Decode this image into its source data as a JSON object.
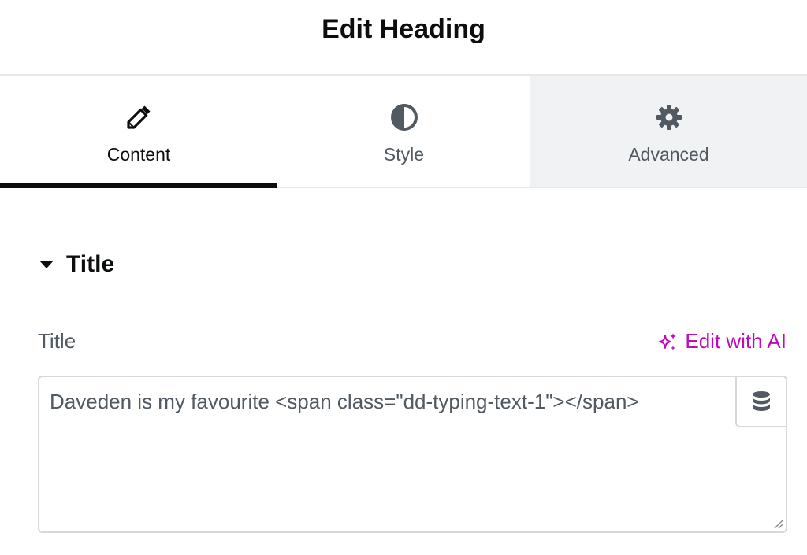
{
  "header": {
    "title": "Edit Heading"
  },
  "tabs": [
    {
      "label": "Content",
      "icon": "pencil-icon",
      "active": true
    },
    {
      "label": "Style",
      "icon": "half-circle-icon",
      "active": false
    },
    {
      "label": "Advanced",
      "icon": "gear-icon",
      "active": false
    }
  ],
  "section": {
    "title": "Title",
    "expanded": true
  },
  "field": {
    "label": "Title",
    "ai_link": "Edit with AI",
    "value": "Daveden is my favourite <span class=\"dd-typing-text-1\"></span>",
    "dynamic_tags_icon": "database-icon"
  },
  "colors": {
    "accent_ai": "#c00bb9",
    "text_primary": "#0c0d0e",
    "text_secondary": "#515962",
    "active_indicator": "#0c0d0e",
    "inactive_tab_bg": "#f1f2f3"
  }
}
